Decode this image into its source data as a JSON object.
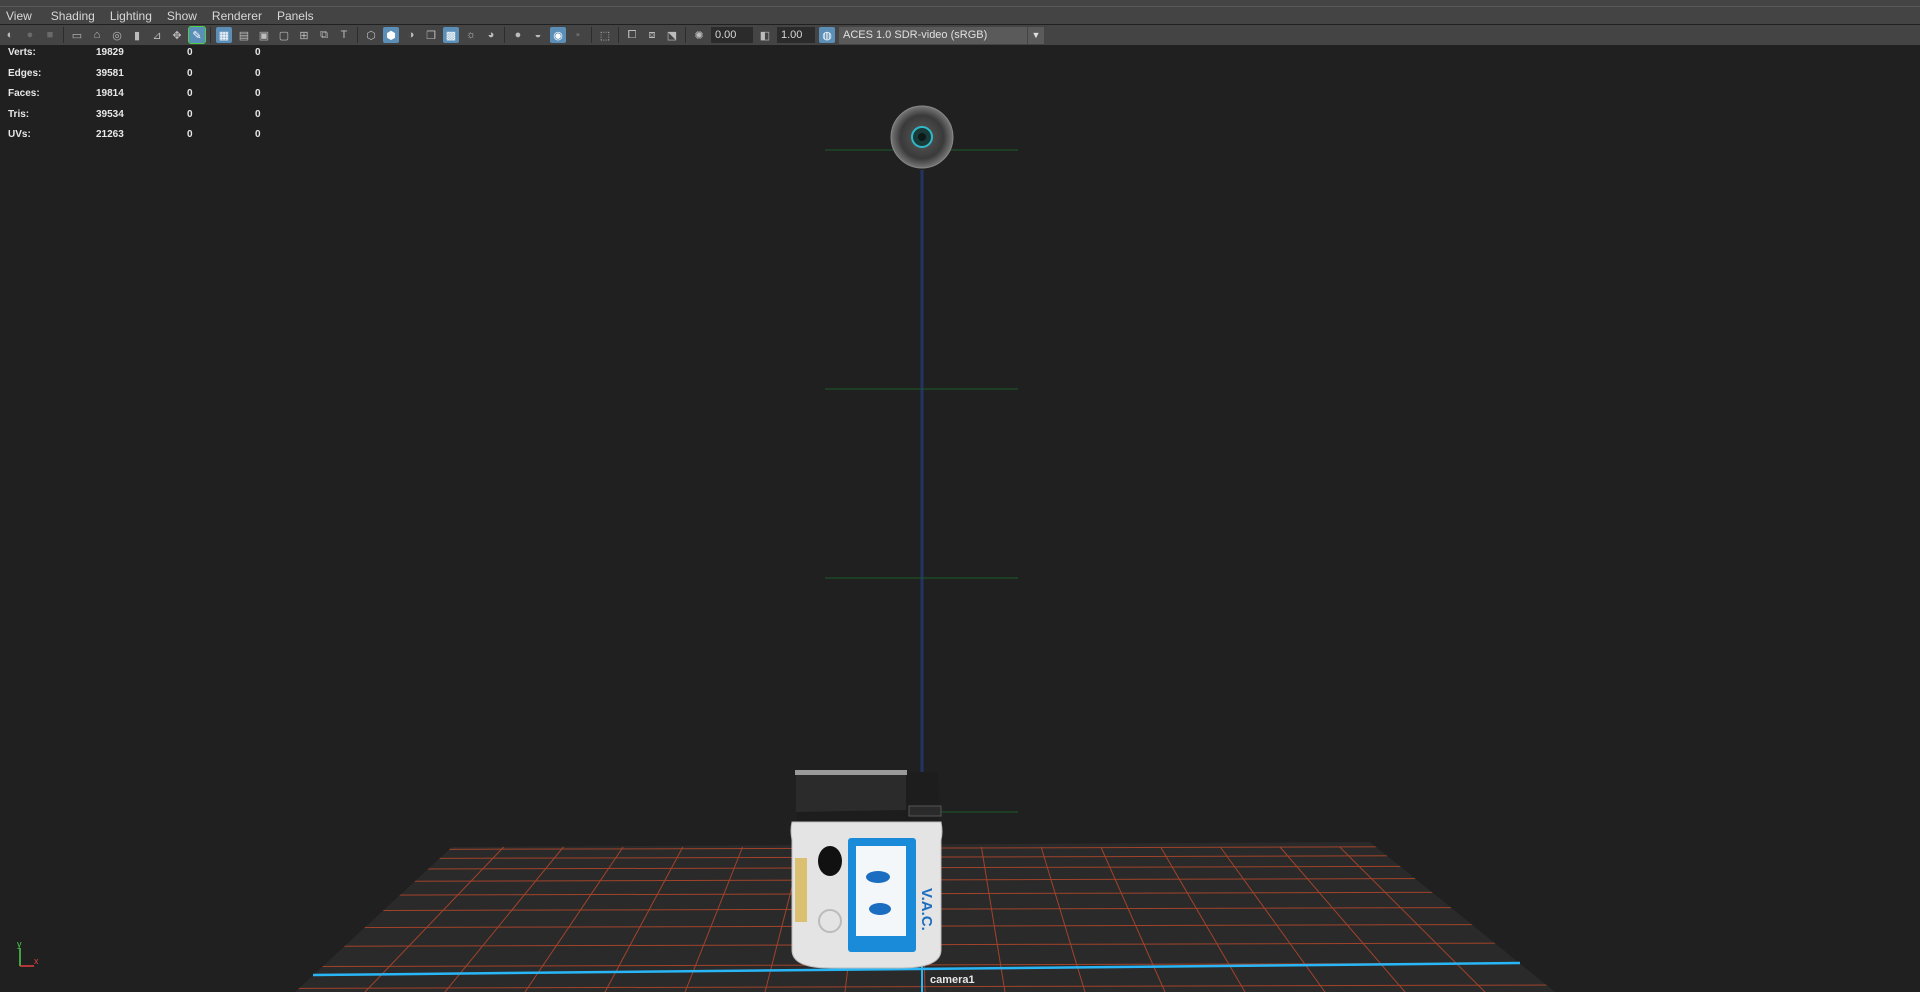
{
  "menu": {
    "items": [
      "View",
      "Shading",
      "Lighting",
      "Show",
      "Renderer",
      "Panels"
    ]
  },
  "toolbar": {
    "exposure_value": "0.00",
    "gamma_value": "1.00",
    "color_space": "ACES 1.0 SDR-video (sRGB)",
    "icons": [
      "select-camera-icon",
      "lock-camera-icon",
      "bookmark-icon",
      "camera-attributes-icon",
      "image-plane-icon",
      "2d-pan-zoom-icon",
      "grease-pencil-icon",
      "grid-icon",
      "film-gate-icon",
      "resolution-gate-icon",
      "gate-mask-icon",
      "field-chart-icon",
      "safe-action-icon",
      "safe-title-icon",
      "wireframe-icon",
      "smooth-shade-icon",
      "flat-shade-icon",
      "bounding-box-icon",
      "textured-icon",
      "use-lights-icon",
      "shadows-icon",
      "ambient-occlusion-icon",
      "antialiasing-icon",
      "depth-of-field-icon",
      "isolate-select-icon",
      "xray-icon",
      "xray-joints-icon",
      "xray-components-icon",
      "exposure-icon",
      "gamma-icon",
      "color-management-icon"
    ]
  },
  "hud": {
    "rows": [
      {
        "label": "Verts:",
        "v1": "19829",
        "v2": "0",
        "v3": "0"
      },
      {
        "label": "Edges:",
        "v1": "39581",
        "v2": "0",
        "v3": "0"
      },
      {
        "label": "Faces:",
        "v1": "19814",
        "v2": "0",
        "v3": "0"
      },
      {
        "label": "Tris:",
        "v1": "39534",
        "v2": "0",
        "v3": "0"
      },
      {
        "label": "UVs:",
        "v1": "21263",
        "v2": "0",
        "v3": "0"
      }
    ]
  },
  "viewport": {
    "camera_name": "camera1",
    "device_text": "V.A.C.",
    "axis": {
      "y": "y",
      "x": "x"
    }
  },
  "colors": {
    "grid": "#c04a2a",
    "axis_line": "#29b6f6",
    "background": "#202020",
    "device_label": "#1a8bd8"
  }
}
